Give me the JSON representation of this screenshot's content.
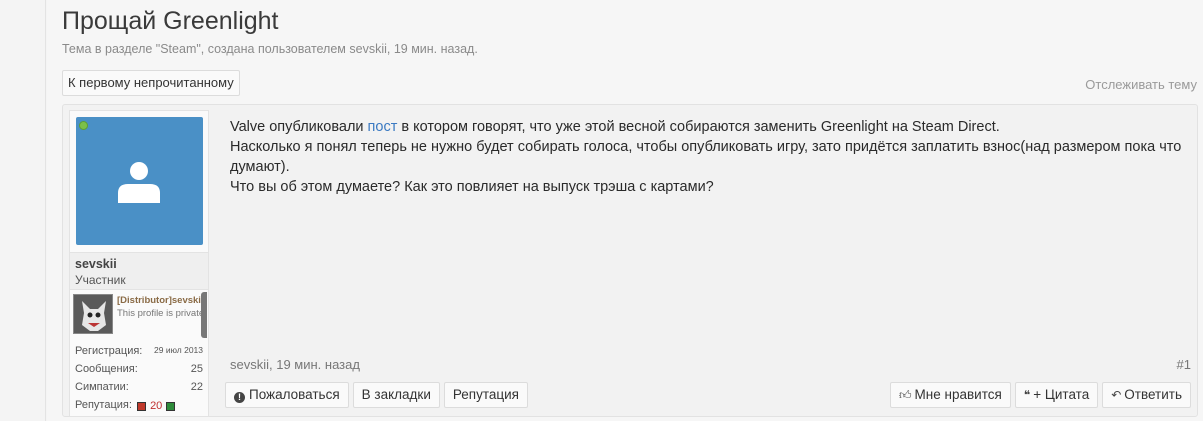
{
  "thread": {
    "title": "Прощай Greenlight",
    "meta": "Тема в разделе \"Steam\", создана пользователем sevskii, 19 мин. назад.",
    "unread_button": "К первому непрочитанному",
    "follow_link": "Отслеживать тему"
  },
  "author": {
    "username": "sevskii",
    "role": "Участник",
    "steam_name": "[Distributor]sevskii",
    "steam_status": "This profile is private",
    "stats": [
      {
        "label": "Регистрация:",
        "value": "29 июл 2013"
      },
      {
        "label": "Сообщения:",
        "value": "25"
      },
      {
        "label": "Симпатии:",
        "value": "22"
      }
    ],
    "reputation_label": "Репутация:",
    "reputation_value": "20"
  },
  "post": {
    "line1_before": "Valve опубликовали ",
    "line1_link": "пост",
    "line1_after": " в котором говорят, что уже этой весной собираются заменить Greenlight на Steam Direct.",
    "line2": "Насколько я понял теперь не нужно будет собирать голоса, чтобы опубликовать игру, зато придётся заплатить взнос(над размером пока что думают).",
    "line3": "Что вы об этом думаете? Как это повлияет на выпуск трэша с картами?",
    "footer_author": "sevskii, 19 мин. назад",
    "number": "#1"
  },
  "actions": {
    "report": "Пожаловаться",
    "bookmark": "В закладки",
    "reputation": "Репутация",
    "like": "Мне нравится",
    "quote": "+ Цитата",
    "reply": "Ответить"
  },
  "colors": {
    "avatar_bg": "#4a90c6",
    "online": "#7cc04a",
    "link": "#3b7ac2"
  }
}
